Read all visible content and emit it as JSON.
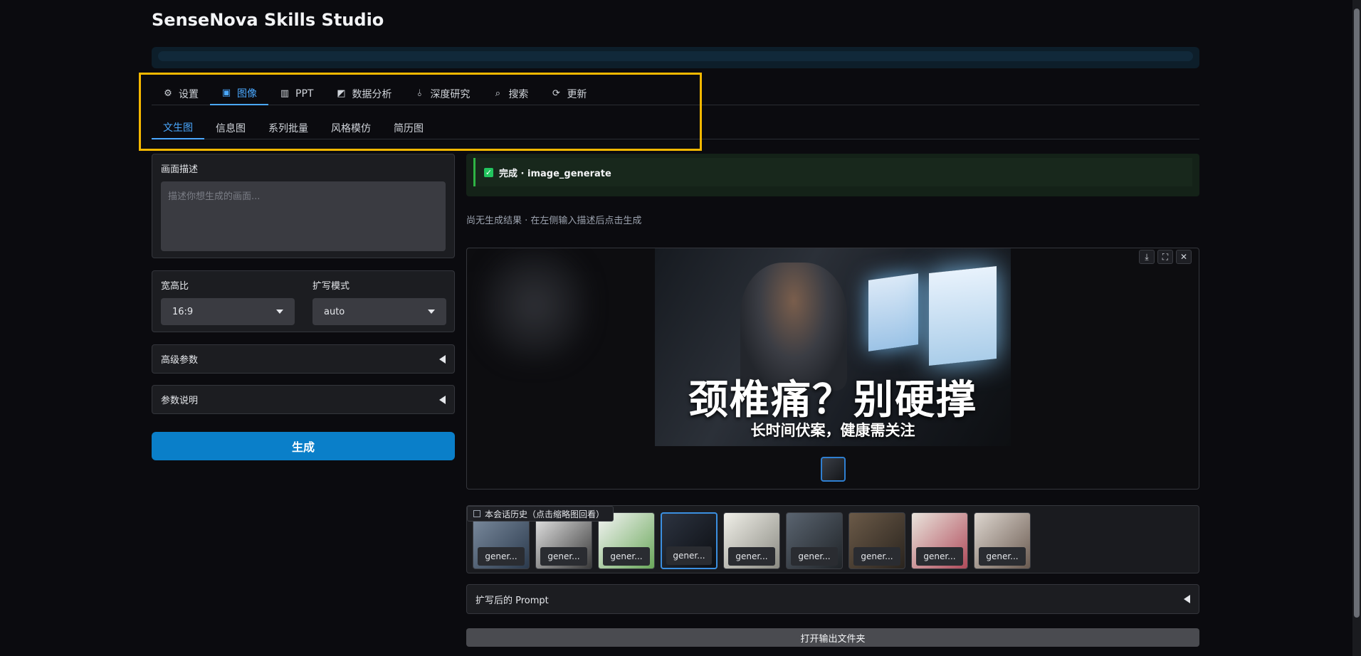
{
  "app": {
    "title": "SenseNova Skills Studio"
  },
  "tabs_top": [
    {
      "label": "设置",
      "icon": "gear-icon",
      "glyph": "⚙"
    },
    {
      "label": "图像",
      "icon": "image-icon",
      "glyph": "▣"
    },
    {
      "label": "PPT",
      "icon": "bar-chart-icon",
      "glyph": "▥"
    },
    {
      "label": "数据分析",
      "icon": "line-chart-icon",
      "glyph": "◩"
    },
    {
      "label": "深度研究",
      "icon": "microscope-icon",
      "glyph": "⫰"
    },
    {
      "label": "搜索",
      "icon": "search-icon",
      "glyph": "⌕"
    },
    {
      "label": "更新",
      "icon": "refresh-icon",
      "glyph": "⟳"
    }
  ],
  "tabs_sub": [
    {
      "label": "文生图"
    },
    {
      "label": "信息图"
    },
    {
      "label": "系列批量"
    },
    {
      "label": "风格模仿"
    },
    {
      "label": "简历图"
    }
  ],
  "left": {
    "description_label": "画面描述",
    "description_placeholder": "描述你想生成的画面...",
    "description_value": "",
    "aspect_label": "宽高比",
    "aspect_value": "16:9",
    "expand_label": "扩写模式",
    "expand_value": "auto",
    "advanced_label": "高级参数",
    "params_help_label": "参数说明",
    "generate_label": "生成"
  },
  "status": {
    "text": "完成 · image_generate"
  },
  "hint": "尚无生成结果 · 在左侧输入描述后点击生成",
  "gallery": {
    "image_title": "颈椎痛？别硬撑",
    "image_subtitle": "长时间伏案，健康需关注",
    "toolbar": [
      "⤓",
      "⛶",
      "✕"
    ]
  },
  "history": {
    "label": "本会话历史（点击缩略图回看）",
    "thumbs": [
      {
        "label": "gener...",
        "bg": "linear-gradient(135deg,#7d8da0,#2b3a4d)"
      },
      {
        "label": "gener...",
        "bg": "linear-gradient(135deg,#e8e8e8,#3a3a3a)"
      },
      {
        "label": "gener...",
        "bg": "linear-gradient(135deg,#f4f4f4,#6aa85a)"
      },
      {
        "label": "gener...",
        "bg": "linear-gradient(135deg,#2c3340,#0c0e12)"
      },
      {
        "label": "gener...",
        "bg": "linear-gradient(135deg,#f0efe8,#8a8a82)"
      },
      {
        "label": "gener...",
        "bg": "linear-gradient(135deg,#5a6470,#202428)"
      },
      {
        "label": "gener...",
        "bg": "linear-gradient(135deg,#6b5a48,#2a241e)"
      },
      {
        "label": "gener...",
        "bg": "linear-gradient(135deg,#e9e4dc,#b04a5a)"
      },
      {
        "label": "gener...",
        "bg": "linear-gradient(135deg,#ddd6cf,#6a5a50)"
      }
    ]
  },
  "prompt_accordion_label": "扩写后的 Prompt",
  "open_folder_label": "打开输出文件夹",
  "colors": {
    "accent": "#4aa8ff",
    "primary_button": "#0a7fc9",
    "success": "#22c55e",
    "highlight": "#f5b800"
  }
}
